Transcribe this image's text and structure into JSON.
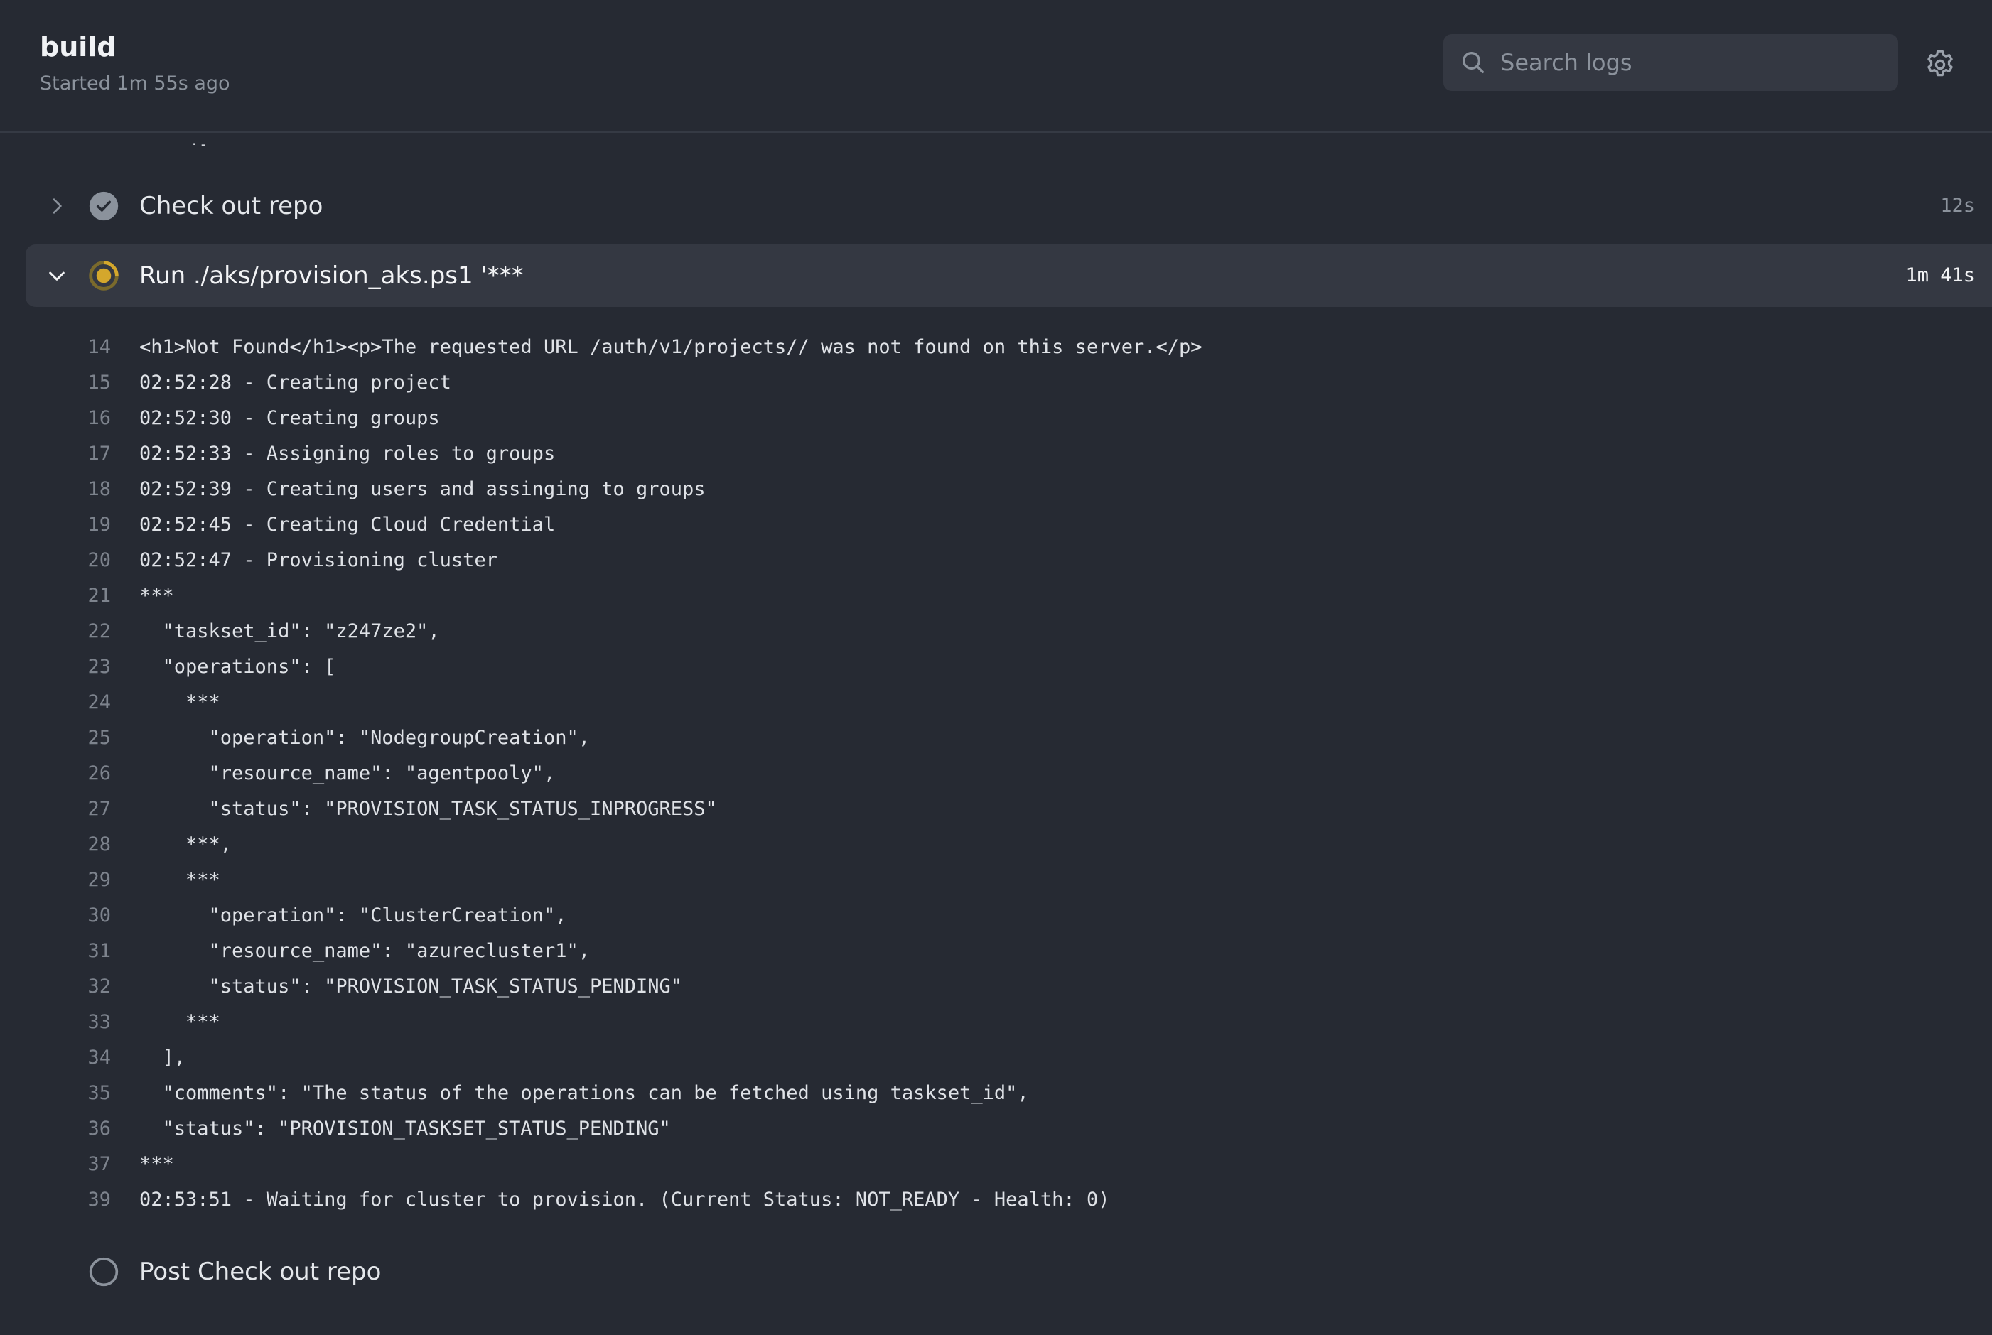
{
  "header": {
    "title": "build",
    "subtitle": "Started 1m 55s ago"
  },
  "search": {
    "placeholder": "Search logs",
    "value": "",
    "icon": "search-icon"
  },
  "settings": {
    "icon": "gear-icon"
  },
  "clipped_previous_text": "· -",
  "steps": [
    {
      "name": "Check out repo",
      "duration": "12s",
      "status": "success",
      "expanded": false,
      "chevron": "chevron-right-icon",
      "status_icon": "check-circle-icon"
    },
    {
      "name": "Run ./aks/provision_aks.ps1 '***",
      "duration": "1m 41s",
      "status": "in_progress",
      "expanded": true,
      "chevron": "chevron-down-icon",
      "status_icon": "in-progress-icon"
    },
    {
      "name": "Post Check out repo",
      "duration": "",
      "status": "queued",
      "expanded": false,
      "status_icon": "pending-circle-icon"
    }
  ],
  "log_lines": [
    {
      "n": "14",
      "text": "<h1>Not Found</h1><p>The requested URL /auth/v1/projects// was not found on this server.</p>"
    },
    {
      "n": "15",
      "text": "02:52:28 - Creating project"
    },
    {
      "n": "16",
      "text": "02:52:30 - Creating groups"
    },
    {
      "n": "17",
      "text": "02:52:33 - Assigning roles to groups"
    },
    {
      "n": "18",
      "text": "02:52:39 - Creating users and assinging to groups"
    },
    {
      "n": "19",
      "text": "02:52:45 - Creating Cloud Credential"
    },
    {
      "n": "20",
      "text": "02:52:47 - Provisioning cluster"
    },
    {
      "n": "21",
      "text": "***"
    },
    {
      "n": "22",
      "text": "  \"taskset_id\": \"z247ze2\","
    },
    {
      "n": "23",
      "text": "  \"operations\": ["
    },
    {
      "n": "24",
      "text": "    ***"
    },
    {
      "n": "25",
      "text": "      \"operation\": \"NodegroupCreation\","
    },
    {
      "n": "26",
      "text": "      \"resource_name\": \"agentpooly\","
    },
    {
      "n": "27",
      "text": "      \"status\": \"PROVISION_TASK_STATUS_INPROGRESS\""
    },
    {
      "n": "28",
      "text": "    ***,"
    },
    {
      "n": "29",
      "text": "    ***"
    },
    {
      "n": "30",
      "text": "      \"operation\": \"ClusterCreation\","
    },
    {
      "n": "31",
      "text": "      \"resource_name\": \"azurecluster1\","
    },
    {
      "n": "32",
      "text": "      \"status\": \"PROVISION_TASK_STATUS_PENDING\""
    },
    {
      "n": "33",
      "text": "    ***"
    },
    {
      "n": "34",
      "text": "  ],"
    },
    {
      "n": "35",
      "text": "  \"comments\": \"The status of the operations can be fetched using taskset_id\","
    },
    {
      "n": "36",
      "text": "  \"status\": \"PROVISION_TASKSET_STATUS_PENDING\""
    },
    {
      "n": "37",
      "text": "***"
    },
    {
      "n": "39",
      "text": "02:53:51 - Waiting for cluster to provision. (Current Status: NOT_READY - Health: 0)"
    }
  ],
  "colors": {
    "background": "#262a33",
    "panel": "#343842",
    "success_icon": "#8b929c",
    "in_progress_icon": "#d4a72c",
    "muted_text": "#8b929c",
    "text": "#dfe2e7"
  }
}
